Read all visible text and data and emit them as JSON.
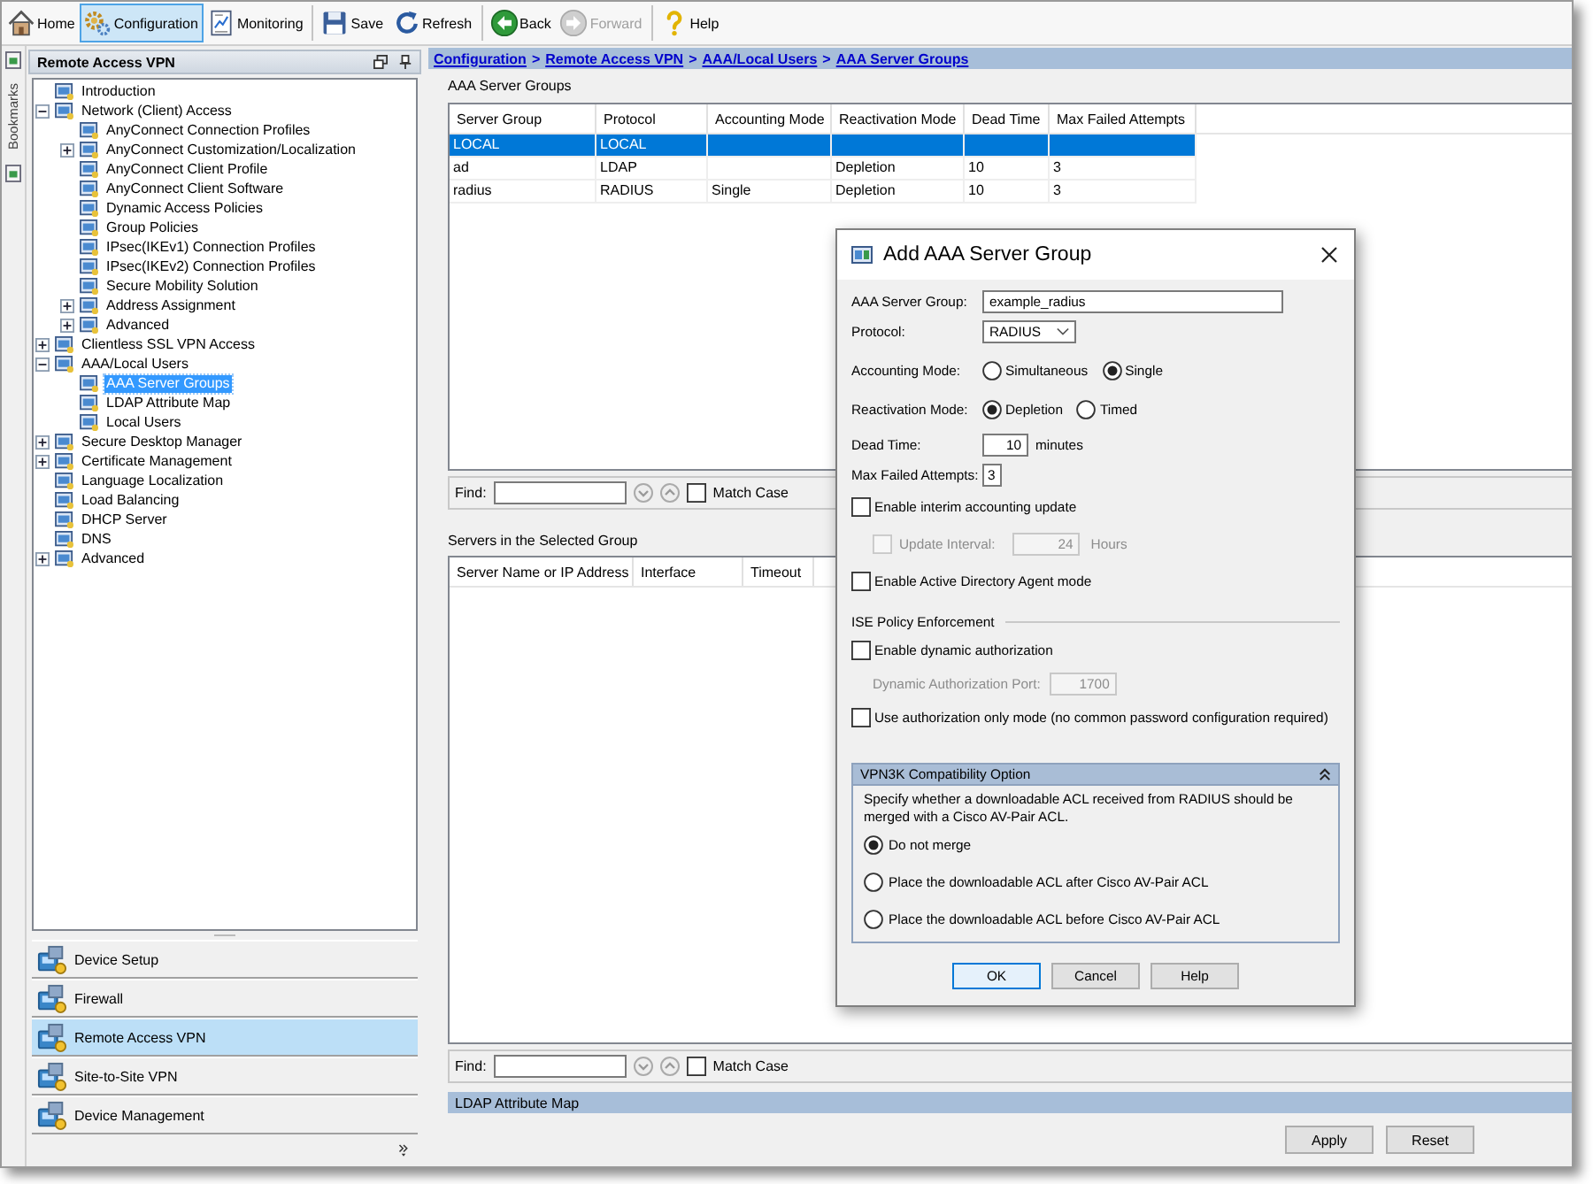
{
  "toolbar": {
    "groups": [
      {
        "buttons": [
          {
            "label": "Home",
            "selected": false,
            "disabled": false
          },
          {
            "label": "Configuration",
            "selected": true,
            "disabled": false
          },
          {
            "label": "Monitoring",
            "selected": false,
            "disabled": false
          }
        ]
      },
      {
        "buttons": [
          {
            "label": "Save",
            "selected": false,
            "disabled": false
          },
          {
            "label": "Refresh",
            "selected": false,
            "disabled": false
          }
        ]
      },
      {
        "buttons": [
          {
            "label": "Back",
            "selected": false,
            "disabled": false
          },
          {
            "label": "Forward",
            "selected": false,
            "disabled": true
          }
        ]
      },
      {
        "buttons": [
          {
            "label": "Help",
            "selected": false,
            "disabled": false
          }
        ]
      }
    ]
  },
  "side_tabs": {
    "bookmarks": "Bookmarks"
  },
  "navigation_panel": {
    "title": "Remote Access VPN",
    "tree": [
      {
        "label": "Introduction",
        "selected": false
      },
      {
        "label": "Network (Client) Access",
        "selected": false,
        "expanded": true,
        "children": [
          {
            "label": "AnyConnect Connection Profiles",
            "selected": false
          },
          {
            "label": "AnyConnect Customization/Localization",
            "selected": false,
            "expanded": false
          },
          {
            "label": "AnyConnect Client Profile",
            "selected": false
          },
          {
            "label": "AnyConnect Client Software",
            "selected": false
          },
          {
            "label": "Dynamic Access Policies",
            "selected": false
          },
          {
            "label": "Group Policies",
            "selected": false
          },
          {
            "label": "IPsec(IKEv1) Connection Profiles",
            "selected": false
          },
          {
            "label": "IPsec(IKEv2) Connection Profiles",
            "selected": false
          },
          {
            "label": "Secure Mobility Solution",
            "selected": false
          },
          {
            "label": "Address Assignment",
            "selected": false,
            "expanded": false
          },
          {
            "label": "Advanced",
            "selected": false,
            "expanded": false
          }
        ]
      },
      {
        "label": "Clientless SSL VPN Access",
        "selected": false,
        "expanded": false
      },
      {
        "label": "AAA/Local Users",
        "selected": false,
        "expanded": true,
        "children": [
          {
            "label": "AAA Server Groups",
            "selected": true
          },
          {
            "label": "LDAP Attribute Map",
            "selected": false
          },
          {
            "label": "Local Users",
            "selected": false
          }
        ]
      },
      {
        "label": "Secure Desktop Manager",
        "selected": false,
        "expanded": false
      },
      {
        "label": "Certificate Management",
        "selected": false,
        "expanded": false
      },
      {
        "label": "Language Localization",
        "selected": false
      },
      {
        "label": "Load Balancing",
        "selected": false
      },
      {
        "label": "DHCP Server",
        "selected": false
      },
      {
        "label": "DNS",
        "selected": false
      },
      {
        "label": "Advanced",
        "selected": false,
        "expanded": false
      }
    ],
    "sections": [
      {
        "label": "Device Setup",
        "selected": false
      },
      {
        "label": "Firewall",
        "selected": false
      },
      {
        "label": "Remote Access VPN",
        "selected": true
      },
      {
        "label": "Site-to-Site VPN",
        "selected": false
      },
      {
        "label": "Device Management",
        "selected": false
      }
    ]
  },
  "breadcrumb": [
    {
      "kind": "link",
      "text": "Configuration"
    },
    {
      "kind": "separator",
      "text": ">"
    },
    {
      "kind": "link",
      "text": "Remote Access VPN"
    },
    {
      "kind": "separator",
      "text": ">"
    },
    {
      "kind": "link",
      "text": "AAA/Local Users"
    },
    {
      "kind": "separator",
      "text": ">"
    },
    {
      "kind": "link",
      "text": "AAA Server Groups"
    }
  ],
  "server_groups": {
    "title": "AAA Server Groups",
    "columns": [
      "Server Group",
      "Protocol",
      "Accounting Mode",
      "Reactivation Mode",
      "Dead Time",
      "Max Failed Attempts"
    ],
    "rows": [
      {
        "cells": [
          "LOCAL",
          "LOCAL",
          null,
          null,
          null,
          null
        ],
        "selected": true
      },
      {
        "cells": [
          "ad",
          "LDAP",
          null,
          "Depletion",
          "10",
          "3"
        ],
        "selected": false
      },
      {
        "cells": [
          "radius",
          "RADIUS",
          "Single",
          "Depletion",
          "10",
          "3"
        ],
        "selected": false
      }
    ],
    "find": {
      "label": "Find:",
      "match_case": {
        "label": "Match Case",
        "checked": false
      }
    }
  },
  "servers": {
    "title": "Servers in the Selected Group",
    "columns": [
      "Server Name or IP Address",
      "Interface",
      "Timeout"
    ],
    "find": {
      "label": "Find:",
      "match_case": {
        "label": "Match Case",
        "checked": false
      }
    }
  },
  "ldap_panel": {
    "title": "LDAP Attribute Map"
  },
  "actions": [
    "Apply",
    "Reset"
  ],
  "dialog": {
    "title": "Add AAA Server Group",
    "server_group": {
      "label": "AAA Server Group:",
      "value": "example_radius"
    },
    "protocol": {
      "label": "Protocol:",
      "value": "RADIUS"
    },
    "accounting_mode": {
      "label": "Accounting Mode:",
      "options": [
        {
          "label": "Simultaneous",
          "selected": false
        },
        {
          "label": "Single",
          "selected": true
        }
      ]
    },
    "reactivation_mode": {
      "label": "Reactivation Mode:",
      "options": [
        {
          "label": "Depletion",
          "selected": true
        },
        {
          "label": "Timed",
          "selected": false
        }
      ]
    },
    "dead_time": {
      "label": "Dead Time:",
      "value": "10",
      "unit": "minutes"
    },
    "max_failed_attempts": {
      "label": "Max Failed Attempts:",
      "value": "3"
    },
    "interim_accounting": {
      "label": "Enable interim accounting update",
      "checked": false
    },
    "update_interval": {
      "label": "Update Interval:",
      "value": "24",
      "unit": "Hours",
      "checked": false,
      "disabled": true
    },
    "ad_agent_mode": {
      "label": "Enable Active Directory Agent mode",
      "checked": false
    },
    "ise_policy": {
      "title": "ISE Policy Enforcement",
      "dynamic_authorization": {
        "label": "Enable dynamic authorization",
        "checked": false
      },
      "port": {
        "label": "Dynamic Authorization Port:",
        "value": "1700",
        "disabled": true
      },
      "authorization_only": {
        "label": "Use authorization only mode (no common password configuration required)",
        "checked": false
      }
    },
    "vpn3k": {
      "title": "VPN3K Compatibility Option",
      "expanded": true,
      "description": "Specify whether a downloadable ACL received from RADIUS should be merged with a Cisco AV-Pair ACL.",
      "options": [
        {
          "label": "Do not merge",
          "selected": true
        },
        {
          "label": "Place the downloadable ACL after Cisco AV-Pair ACL",
          "selected": false
        },
        {
          "label": "Place the downloadable ACL before Cisco AV-Pair ACL",
          "selected": false
        }
      ]
    },
    "buttons": [
      {
        "label": "OK",
        "default": true
      },
      {
        "label": "Cancel",
        "default": false
      },
      {
        "label": "Help",
        "default": false
      }
    ]
  }
}
